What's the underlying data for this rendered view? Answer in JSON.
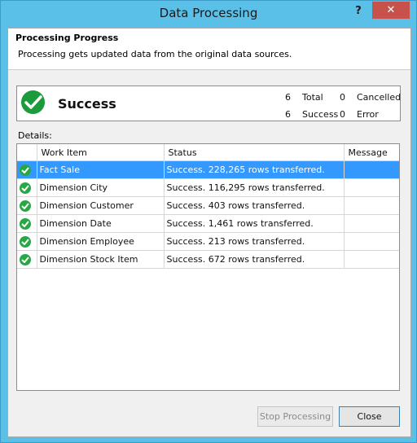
{
  "window": {
    "title": "Data Processing",
    "help_label": "?",
    "close_label": "✕"
  },
  "header": {
    "title": "Processing Progress",
    "subtitle": "Processing gets updated data from the original data sources."
  },
  "status": {
    "result": "Success",
    "total_count": "6",
    "total_label": "Total",
    "cancelled_count": "0",
    "cancelled_label": "Cancelled",
    "success_count": "6",
    "success_label": "Success",
    "error_count": "0",
    "error_label": "Error"
  },
  "details": {
    "label": "Details:",
    "columns": [
      "",
      "Work Item",
      "Status",
      "Message"
    ],
    "rows": [
      {
        "item": "Fact Sale",
        "status": "Success. 228,265 rows transferred.",
        "message": ""
      },
      {
        "item": "Dimension City",
        "status": "Success. 116,295 rows transferred.",
        "message": ""
      },
      {
        "item": "Dimension Customer",
        "status": "Success. 403 rows transferred.",
        "message": ""
      },
      {
        "item": "Dimension Date",
        "status": "Success. 1,461 rows transferred.",
        "message": ""
      },
      {
        "item": "Dimension Employee",
        "status": "Success. 213 rows transferred.",
        "message": ""
      },
      {
        "item": "Dimension Stock Item",
        "status": "Success. 672 rows transferred.",
        "message": ""
      }
    ]
  },
  "buttons": {
    "stop": "Stop Processing",
    "close": "Close"
  },
  "colors": {
    "accent": "#5bc0e8",
    "success": "#1b9b3a",
    "selection": "#3399ff",
    "close": "#c7514b"
  }
}
